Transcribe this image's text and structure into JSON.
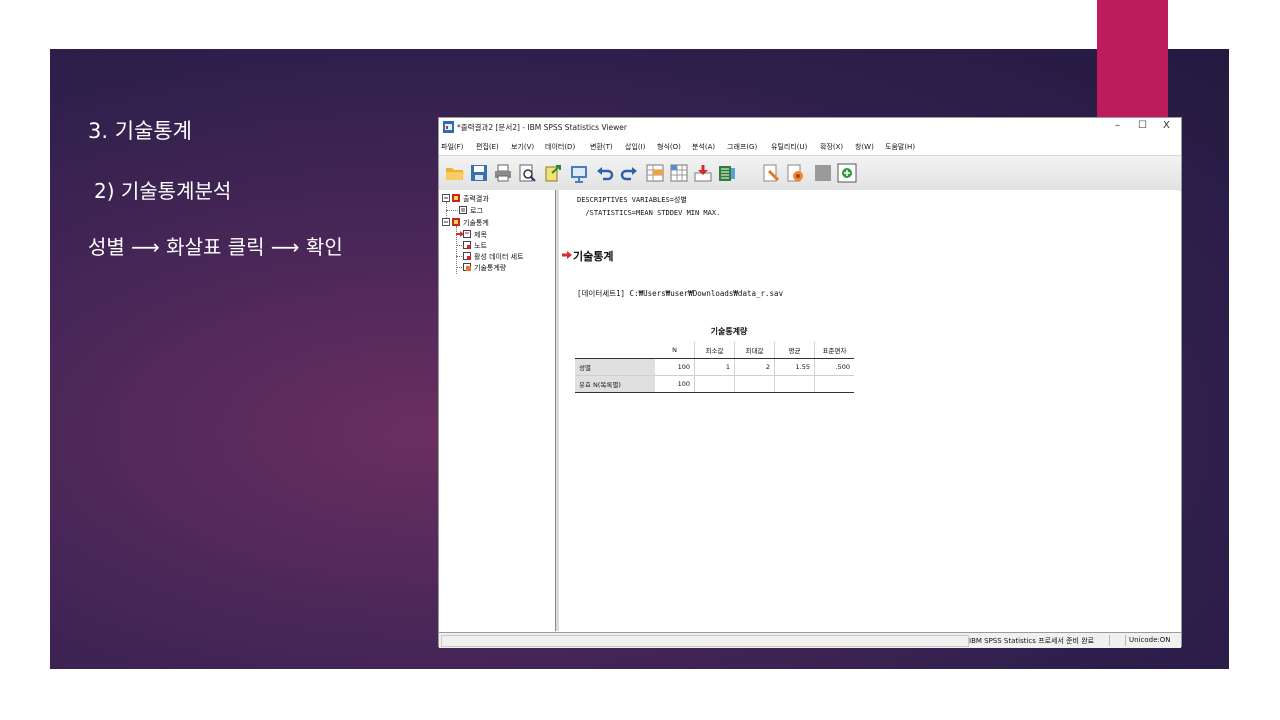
{
  "slide": {
    "heading": "3. 기술통계",
    "subheading": "2) 기술통계분석",
    "instruction": "성별 ⟶ 화살표 클릭 ⟶ 확인"
  },
  "colors": {
    "accent": "#be1a5e",
    "slide_bg": "#3a2352"
  },
  "window": {
    "title": "*출력결과2 [문서2] - IBM SPSS Statistics Viewer",
    "controls": {
      "minimize": "–",
      "maximize": "☐",
      "close": "X"
    }
  },
  "menu": [
    "파일(F)",
    "편집(E)",
    "보기(V)",
    "데이터(D)",
    "변환(T)",
    "삽입(I)",
    "형식(O)",
    "분석(A)",
    "그래프(G)",
    "유틸리티(U)",
    "확장(X)",
    "창(W)",
    "도움말(H)"
  ],
  "toolbar_icons": [
    "open-icon",
    "save-icon",
    "print-icon",
    "print-preview-icon",
    "export-icon",
    "recall-dialog-icon",
    "undo-icon",
    "redo-icon",
    "goto-data-icon",
    "goto-case-icon",
    "goto-variable-icon",
    "variables-icon",
    "create-title-icon",
    "create-text-icon",
    "disabled-icon",
    "designate-window-icon"
  ],
  "outline": {
    "root": "출력결과",
    "log": "로그",
    "section": "기술통계",
    "items": [
      "제목",
      "노트",
      "활성 데이터 세트",
      "기술통계량"
    ]
  },
  "content": {
    "syntax_line1": "DESCRIPTIVES VARIABLES=성별",
    "syntax_line2": "  /STATISTICS=MEAN STDDEV MIN MAX.",
    "section_title": "기술통계",
    "dataset": "[데이터세트1] C:₩Users₩user₩Downloads₩data_r.sav",
    "table": {
      "title": "기술통계량",
      "headers": [
        "N",
        "최소값",
        "최대값",
        "평균",
        "표준편차"
      ],
      "rows": [
        {
          "label": "성별",
          "values": [
            "100",
            "1",
            "2",
            "1.55",
            ".500"
          ]
        },
        {
          "label": "유효 N(목록별)",
          "values": [
            "100",
            "",
            "",
            "",
            ""
          ]
        }
      ]
    }
  },
  "status": {
    "message": "IBM SPSS Statistics 프로세서 준비 완료",
    "unicode": "Unicode:ON"
  }
}
